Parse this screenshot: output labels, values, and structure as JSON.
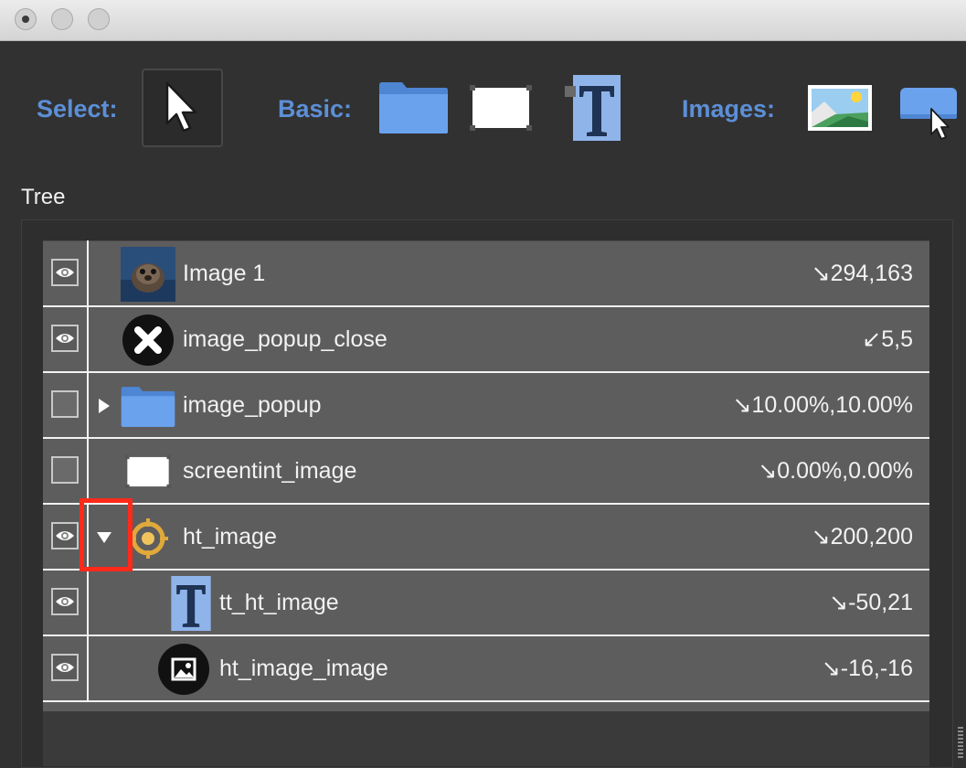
{
  "toolbar": {
    "select_label": "Select:",
    "basic_label": "Basic:",
    "images_label": "Images:"
  },
  "tree": {
    "title": "Tree",
    "rows": [
      {
        "name": "Image 1",
        "coord": "↘294,163",
        "visible": true
      },
      {
        "name": "image_popup_close",
        "coord": "↙5,5",
        "visible": true
      },
      {
        "name": "image_popup",
        "coord": "↘10.00%,10.00%",
        "visible": false,
        "expander": "collapsed"
      },
      {
        "name": "screentint_image",
        "coord": "↘0.00%,0.00%",
        "visible": false
      },
      {
        "name": "ht_image",
        "coord": "↘200,200",
        "visible": true,
        "expander": "expanded"
      },
      {
        "name": "tt_ht_image",
        "coord": "↘-50,21",
        "visible": true
      },
      {
        "name": "ht_image_image",
        "coord": "↘-16,-16",
        "visible": true
      }
    ]
  },
  "colors": {
    "accent": "#5c8fd6",
    "highlight": "#ff2a1a",
    "row_background": "#5d5d5d"
  },
  "icons": [
    "pointer-icon",
    "folder-icon",
    "rectangle-icon",
    "text-icon",
    "image-icon",
    "button-icon",
    "eye-icon",
    "seal-thumbnail",
    "close-icon",
    "hotspot-icon",
    "picture-icon"
  ]
}
